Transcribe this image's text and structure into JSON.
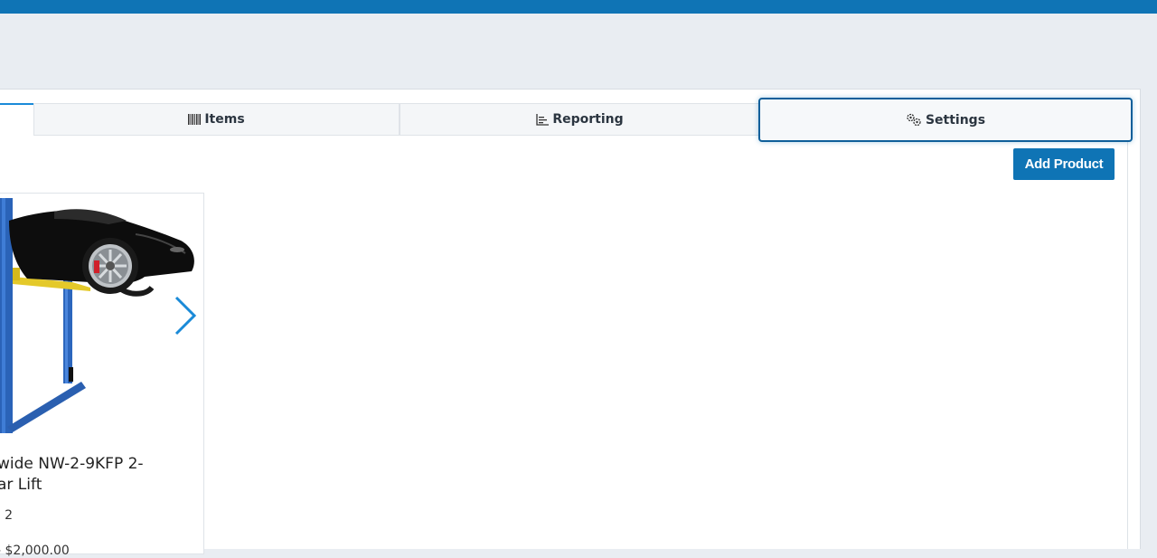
{
  "tabs": [
    {
      "label": "Items",
      "icon": "barcode-icon"
    },
    {
      "label": "Reporting",
      "icon": "chart-bars-icon"
    },
    {
      "label": "Settings",
      "icon": "gears-icon"
    }
  ],
  "toolbar": {
    "add_product_label": "Add Product"
  },
  "product": {
    "title": "wide NW-2-9KFP 2-\nar Lift",
    "meta": ": 2",
    "price": "- $2,000.00",
    "image": "car-lift-image"
  },
  "colors": {
    "brand": "#0f74b5",
    "tab_focus": "#0f5f9a",
    "arrow": "#1a8ad8"
  }
}
